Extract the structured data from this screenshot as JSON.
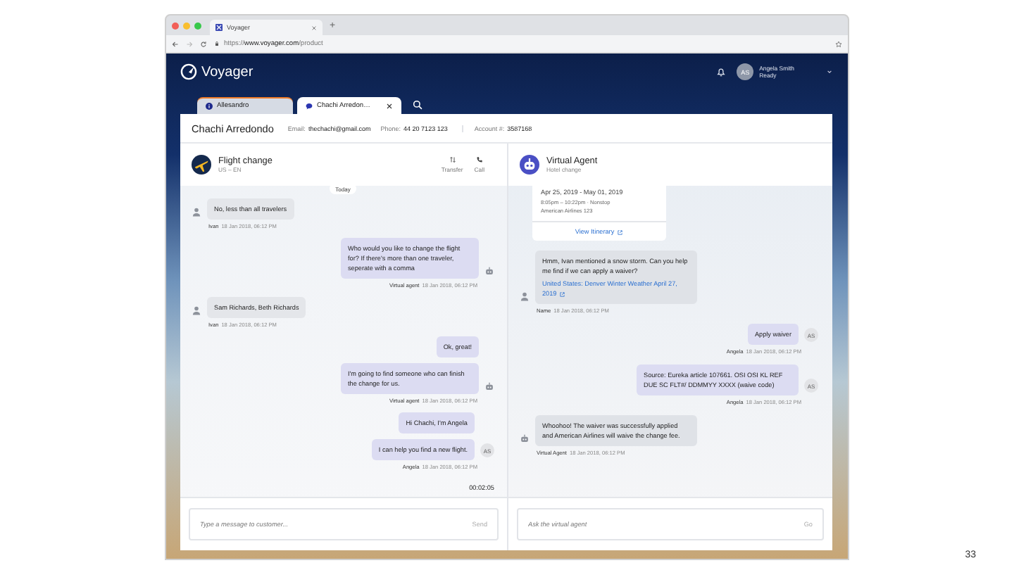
{
  "browser": {
    "tab_title": "Voyager",
    "new_tab": "+",
    "url": "https://**www.voyager.com**/product"
  },
  "app": {
    "logo": "Voyager",
    "user": {
      "initials": "AS",
      "name": "Angela Smith",
      "status": "Ready"
    }
  },
  "tabs": [
    {
      "label": "Allesandro",
      "selected": false,
      "alert": true
    },
    {
      "label": "Chachi Arredon…",
      "selected": true,
      "alert": false
    }
  ],
  "customer": {
    "name": "Chachi Arredondo",
    "fields": [
      {
        "label": "Email:",
        "value": "thechachi@gmail.com"
      },
      {
        "label": "Phone:",
        "value": "44 20 7123 123"
      },
      {
        "label": "Account #:",
        "value": "3587168"
      }
    ]
  },
  "conversation": {
    "title": "Flight change",
    "subtitle": "US – EN",
    "actions": [
      {
        "label": "Transfer"
      },
      {
        "label": "Call"
      }
    ],
    "date_divider": "Today",
    "messages": [
      {
        "kind": "customer",
        "bubbles": [
          "No, less than all travelers"
        ],
        "author": "Ivan",
        "time": "18 Jan 2018, 06:12 PM"
      },
      {
        "kind": "assistant",
        "bubbles": [
          "Who would you like to change the flight for? If there's more than one traveler, seperate with a comma"
        ],
        "author": "Virtual agent",
        "time": "18 Jan 2018, 06:12 PM"
      },
      {
        "kind": "customer",
        "bubbles": [
          "Sam Richards, Beth Richards"
        ],
        "author": "Ivan",
        "time": "18 Jan 2018, 06:12 PM"
      },
      {
        "kind": "assistant",
        "bubbles": [
          "Ok, great!",
          "I'm going to find someone who can finish the change for us."
        ],
        "author": "Virtual agent",
        "time": "18 Jan 2018, 06:12 PM"
      },
      {
        "kind": "agent",
        "initials": "AS",
        "bubbles": [
          "Hi Chachi, I'm Angela",
          "I can help you find a new flight."
        ],
        "author": "Angela",
        "time": "18 Jan 2018, 06:12 PM"
      }
    ],
    "timer": "00:02:05",
    "input": {
      "placeholder": "Type a message to customer...",
      "button": "Send"
    }
  },
  "assistant": {
    "title": "Virtual Agent",
    "subtitle": "Hotel change",
    "card": {
      "dates": "Apr 25, 2019 - May 01, 2019",
      "details": [
        "8:05pm – 10:22pm · Nonstop",
        "American Airlines 123"
      ],
      "link": "View Itinerary"
    },
    "messages": [
      {
        "kind": "customer",
        "bubbles": [
          "Hmm, Ivan mentioned a snow storm. Can you help me find if we can apply a waiver?"
        ],
        "link": "United States: Denver Winter Weather April 27, 2019",
        "author": "Name",
        "time": "18 Jan 2018, 06:12 PM"
      },
      {
        "kind": "agent",
        "initials": "AS",
        "bubbles": [
          "Apply waiver"
        ],
        "author": "Angela",
        "time": "18 Jan 2018, 06:12 PM"
      },
      {
        "kind": "agent",
        "initials": "AS",
        "bubbles": [
          "Source: Eureka article 107661. OSI OSI KL REF DUE SC FLT#/ DDMMYY XXXX (waive code)"
        ],
        "author": "Angela",
        "time": "18 Jan 2018, 06:12 PM"
      },
      {
        "kind": "bot",
        "bubbles": [
          "Whoohoo! The waiver was successfully applied and American Airlines will waive the change fee."
        ],
        "author": "Virtual Agent",
        "time": "18 Jan 2018, 06:12 PM"
      }
    ],
    "input": {
      "placeholder": "Ask the virtual agent",
      "button": "Go"
    }
  },
  "page_number": "33"
}
